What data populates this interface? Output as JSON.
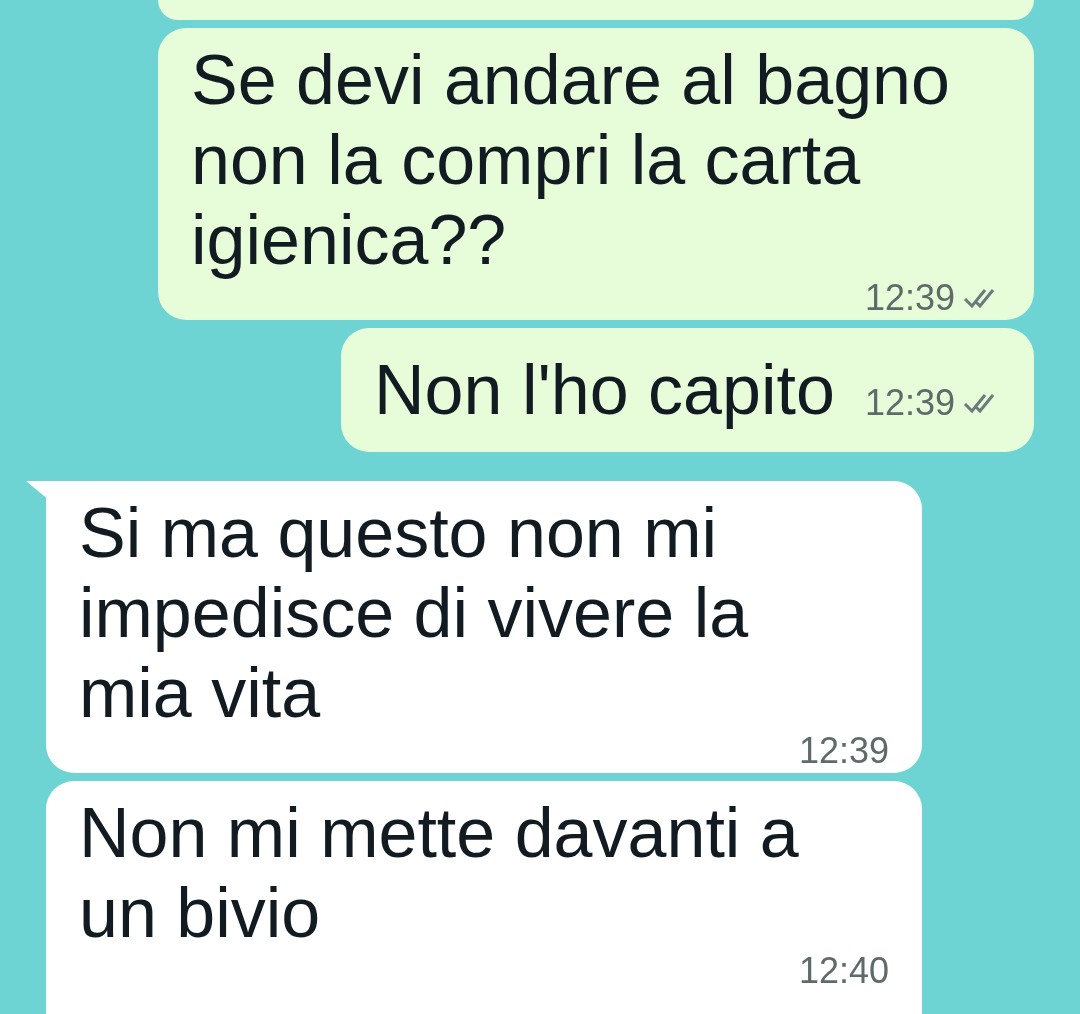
{
  "messages": [
    {
      "kind": "outgoing",
      "cut": true
    },
    {
      "kind": "outgoing",
      "text": "Se devi andare al bagno non la compri la carta igienica??",
      "time": "12:39",
      "read": false
    },
    {
      "kind": "outgoing",
      "text": "Non l'ho capito",
      "time": "12:39",
      "read": false,
      "single_line": true
    },
    {
      "kind": "incoming",
      "text": "Si ma questo non mi impedisce di vivere la mia vita",
      "time": "12:39",
      "tail": true
    },
    {
      "kind": "incoming",
      "text": "Non mi mette davanti a un bivio",
      "time": "12:40"
    }
  ]
}
